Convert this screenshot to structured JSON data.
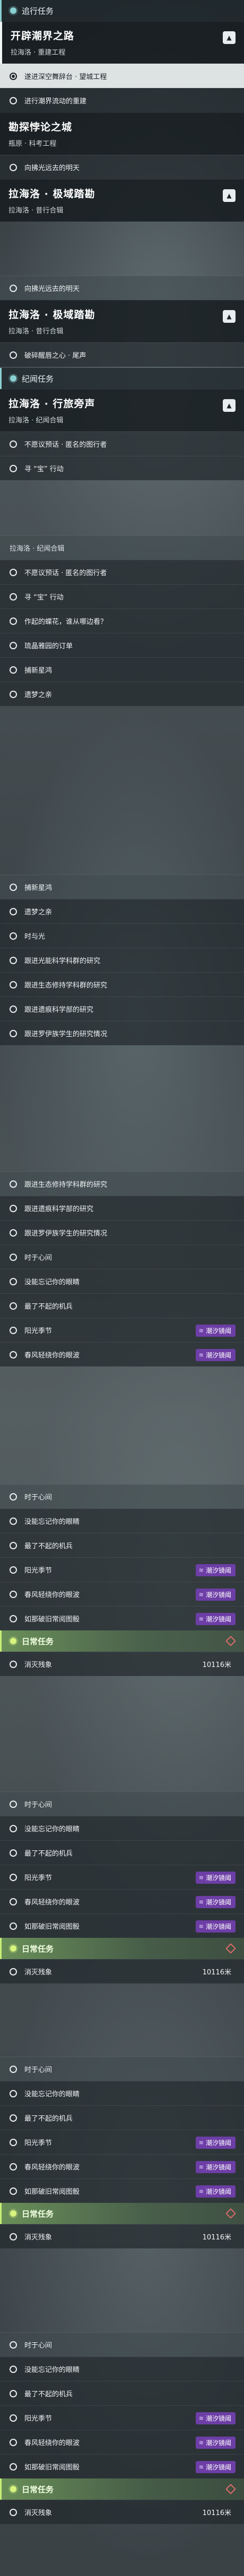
{
  "theme": {
    "accent": "#8ad0d2",
    "daily_accent": "#c7ef76",
    "badge_color": "#6d3ea6",
    "pin_color": "#e16a6a"
  },
  "sections": {
    "tracked": "追行任务",
    "legend": "纪闻任务",
    "daily": "日常任务"
  },
  "quests": {
    "q1": {
      "title": "开辟潮界之路",
      "sub": "拉海洛 · 重建工程"
    },
    "q2": {
      "title": "勘探悖论之城",
      "sub": "瓶原 · 科考工程"
    },
    "q3": {
      "title": "拉海洛 · 极域踏勘",
      "sub": "拉海洛 · 昔行合辑"
    },
    "q4": {
      "title": "拉海洛 · 行旅旁声",
      "sub": "拉海洛 · 纪闻合辑"
    }
  },
  "objectives": {
    "o1": "遂进深空舞辞台 · 望城工程",
    "o2": "进行潮界流动的重建",
    "o3": "向拂光远去的明天",
    "o4": "向拂光远去的明天",
    "o5": "破碎醒唇之心 · 尾声",
    "o6": "不愿议预话 · 匿名的图行者",
    "o7": "寻 “宝” 行动",
    "o8": "不愿议预话 · 匿名的图行者",
    "o9": "寻 “宝” 行动",
    "o10": "作起的蝶花，谁从哪边看？",
    "o11": "琉晶雅园的订单",
    "o12": "捕新星鸿",
    "o13": "遗梦之亲",
    "o14": "捕新星鸿",
    "o15": "遗梦之亲",
    "o16": "时与光",
    "o17": "跟进光能科学科群的研究",
    "o18": "跟进生态修持学科群的研究",
    "o19": "跟进遗痕科学部的研究",
    "o20": "跟进罗伊族学生的研究情况",
    "o21": "跟进生态修持学科群的研究",
    "o22": "跟进遗痕科学部的研究",
    "o23": "跟进罗伊族学生的研究情况",
    "o24": "时于心间",
    "o25": "没能忘记你的眼睛",
    "o26": "最了不起的机兵",
    "o27": "阳光季节",
    "o28": "春风轻绕你的眼波",
    "o29": "时于心间",
    "o30": "没能忘记你的眼睛",
    "o31": "最了不起的机兵",
    "o32": "阳光季节",
    "o33": "春风轻绕你的眼波",
    "o34": "如那破旧常阅图骰",
    "o35": "消灭残象",
    "o36": "时于心间",
    "o37": "没能忘记你的眼睛",
    "o38": "最了不起的机兵",
    "o39": "阳光季节",
    "o40": "春风轻绕你的眼波",
    "o41": "如那破旧常阅图骰",
    "o42": "消灭残象",
    "o43": "时于心间",
    "o44": "没能忘记你的眼睛",
    "o45": "最了不起的机兵",
    "o46": "阳光季节",
    "o47": "春风轻绕你的眼波",
    "o48": "如那破旧常阅图骰",
    "o49": "消灭残象",
    "o50": "时于心间",
    "o51": "没能忘记你的眼睛",
    "o52": "最了不起的机兵",
    "o53": "阳光季节",
    "o54": "春风轻绕你的眼波",
    "o55": "如那破旧常阅图骰",
    "o56": "消灭残象"
  },
  "badge": {
    "label": "潮汐镜阈",
    "icon": "wave-icon"
  },
  "daily_amount": "10116米"
}
